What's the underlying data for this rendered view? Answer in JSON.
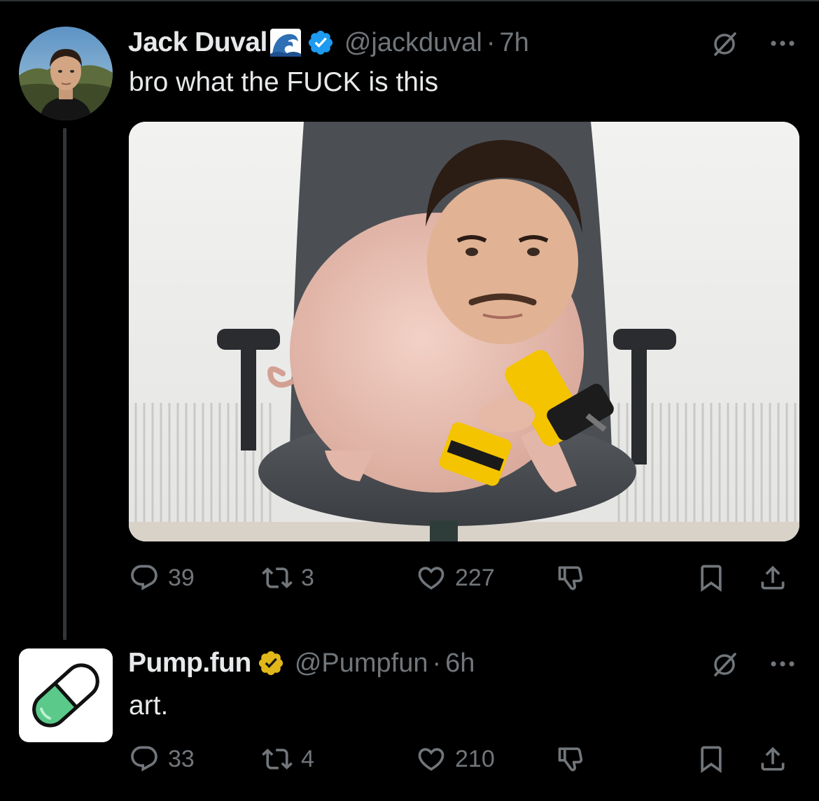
{
  "colors": {
    "background": "#000000",
    "text_primary": "#e7e9ea",
    "text_secondary": "#71767b",
    "verified_blue": "#1d9bf0",
    "verified_gold": "#e2b719",
    "pill_green": "#5ac98a"
  },
  "tweets": [
    {
      "display_name": "Jack Duval",
      "name_emoji": "wave-emoji",
      "verified": "blue-checkmark-icon",
      "handle": "@jackduval",
      "separator": "·",
      "time": "7h",
      "text": "bro what the FUCK is this",
      "media": "image: pig body with a man's face sitting on an office chair holding a yellow power drill",
      "stats": {
        "replies": "39",
        "retweets": "3",
        "likes": "227"
      }
    },
    {
      "display_name": "Pump.fun",
      "verified": "gold-checkmark-icon",
      "handle": "@Pumpfun",
      "separator": "·",
      "time": "6h",
      "text": "art.",
      "stats": {
        "replies": "33",
        "retweets": "4",
        "likes": "210"
      }
    }
  ]
}
